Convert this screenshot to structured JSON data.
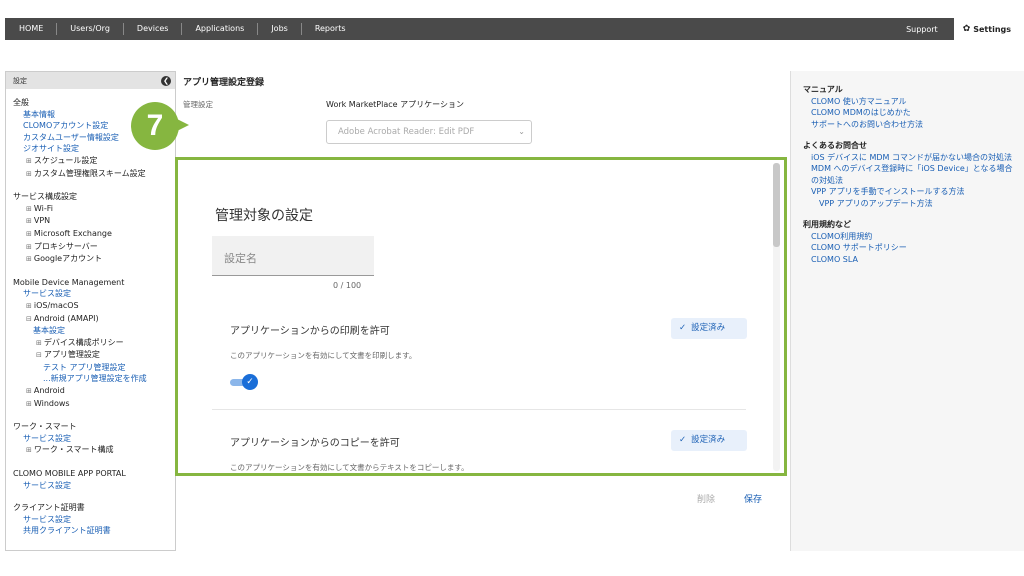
{
  "topnav": {
    "items": [
      "HOME",
      "Users/Org",
      "Devices",
      "Applications",
      "Jobs",
      "Reports"
    ],
    "support": "Support",
    "settings": "Settings"
  },
  "sidebar": {
    "header": "設定",
    "groups": [
      {
        "title": "全般",
        "items": [
          {
            "label": "基本情報",
            "type": "link"
          },
          {
            "label": "CLOMOアカウント設定",
            "type": "link"
          },
          {
            "label": "カスタムユーザー情報設定",
            "type": "link"
          },
          {
            "label": "ジオサイト設定",
            "type": "link"
          },
          {
            "label": "スケジュール設定",
            "type": "expand"
          },
          {
            "label": "カスタム管理権限スキーム設定",
            "type": "expand"
          }
        ]
      },
      {
        "title": "サービス構成設定",
        "items": [
          {
            "label": "Wi-Fi",
            "type": "expand"
          },
          {
            "label": "VPN",
            "type": "expand"
          },
          {
            "label": "Microsoft Exchange",
            "type": "expand"
          },
          {
            "label": "プロキシサーバー",
            "type": "expand"
          },
          {
            "label": "Googleアカウント",
            "type": "expand"
          }
        ]
      },
      {
        "title": "Mobile Device Management",
        "items": [
          {
            "label": "サービス設定",
            "type": "link"
          },
          {
            "label": "iOS/macOS",
            "type": "expand"
          },
          {
            "label": "Android (AMAPI)",
            "type": "collapse"
          },
          {
            "label": "基本設定",
            "type": "link2"
          },
          {
            "label": "デバイス構成ポリシー",
            "type": "expand2"
          },
          {
            "label": "アプリ管理設定",
            "type": "collapse2"
          },
          {
            "label": "テスト アプリ管理設定",
            "type": "link3"
          },
          {
            "label": "...新規アプリ管理設定を作成",
            "type": "link3"
          },
          {
            "label": "Android",
            "type": "expand"
          },
          {
            "label": "Windows",
            "type": "expand"
          }
        ]
      },
      {
        "title": "ワーク・スマート",
        "items": [
          {
            "label": "サービス設定",
            "type": "link"
          },
          {
            "label": "ワーク・スマート構成",
            "type": "expand"
          }
        ]
      },
      {
        "title": "CLOMO MOBILE APP PORTAL",
        "items": [
          {
            "label": "サービス設定",
            "type": "link"
          }
        ]
      },
      {
        "title": "クライアント証明書",
        "items": [
          {
            "label": "サービス設定",
            "type": "link"
          },
          {
            "label": "共用クライアント証明書",
            "type": "link"
          }
        ]
      }
    ]
  },
  "main": {
    "title": "アプリ管理設定登録",
    "row_label": "管理設定",
    "row_value": "Work MarketPlace アプリケーション",
    "select_value": "Adobe Acrobat Reader: Edit PDF",
    "callout_number": "7",
    "panel_title": "管理対象の設定",
    "name_placeholder": "設定名",
    "counter": "0 / 100",
    "options": [
      {
        "title": "アプリケーションからの印刷を許可",
        "desc": "このアプリケーションを有効にして文書を印刷します。",
        "badge": "設定済み"
      },
      {
        "title": "アプリケーションからのコピーを許可",
        "desc": "このアプリケーションを有効にして文書からテキストをコピーします。",
        "badge": "設定済み"
      }
    ],
    "delete": "削除",
    "save": "保存"
  },
  "right": {
    "sections": [
      {
        "title": "マニュアル",
        "links": [
          "CLOMO 使い方マニュアル",
          "CLOMO MDMのはじめかた",
          "サポートへのお問い合わせ方法"
        ]
      },
      {
        "title": "よくあるお問合せ",
        "links": [
          "iOS デバイスに MDM コマンドが届かない場合の対処法",
          "MDM へのデバイス登録時に「iOS Device」となる場合の対処法",
          "VPP アプリを手動でインストールする方法",
          "VPP アプリのアップデート方法"
        ]
      },
      {
        "title": "利用規約など",
        "links": [
          "CLOMO利用規約",
          "CLOMO サポートポリシー",
          "CLOMO SLA"
        ]
      }
    ]
  }
}
